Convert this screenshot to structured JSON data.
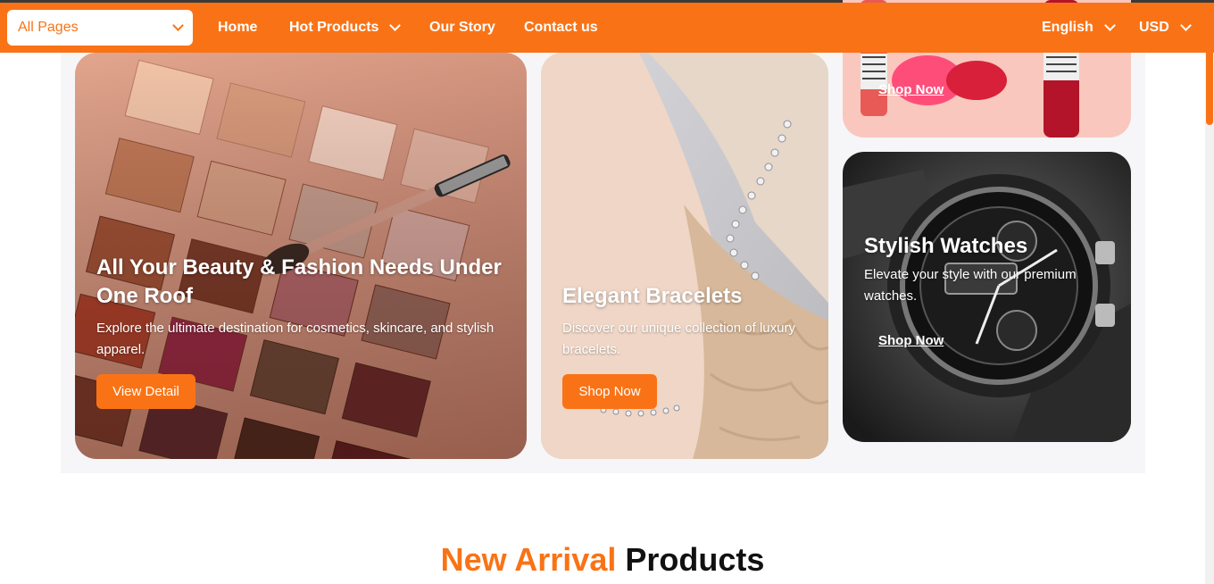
{
  "navbar": {
    "page_select": "All Pages",
    "links": [
      "Home",
      "Hot Products",
      "Our Story",
      "Contact us"
    ],
    "language": "English",
    "currency": "USD",
    "accent_color": "#f97316"
  },
  "cards": {
    "main": {
      "title": "All Your Beauty & Fashion Needs Under One Roof",
      "description": "Explore the ultimate destination for cosmetics, skincare, and stylish apparel.",
      "button": "View Detail"
    },
    "bracelets": {
      "title": "Elegant Bracelets",
      "description": "Discover our unique collection of luxury bracelets.",
      "button": "Shop Now"
    },
    "lipstick": {
      "link": "Shop Now"
    },
    "watches": {
      "title": "Stylish Watches",
      "description": "Elevate your style with our premium watches.",
      "link": "Shop Now"
    }
  },
  "section": {
    "heading_accent": "New Arrival",
    "heading_rest": "Products"
  }
}
